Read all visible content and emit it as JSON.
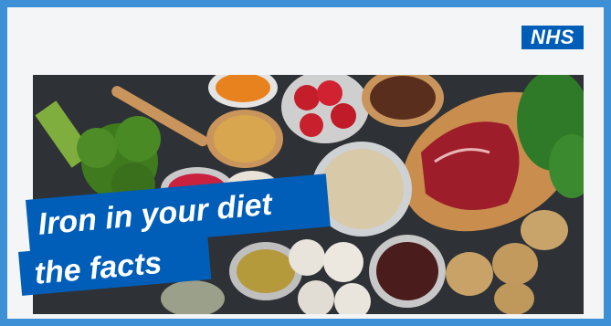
{
  "logo": {
    "text": "NHS",
    "color": "#005eb8"
  },
  "headline": {
    "line1": "Iron in your diet",
    "line2": "the facts"
  },
  "colors": {
    "frame": "#3d8fd6",
    "banner": "#005eb8",
    "card": "#f3f5f6"
  }
}
